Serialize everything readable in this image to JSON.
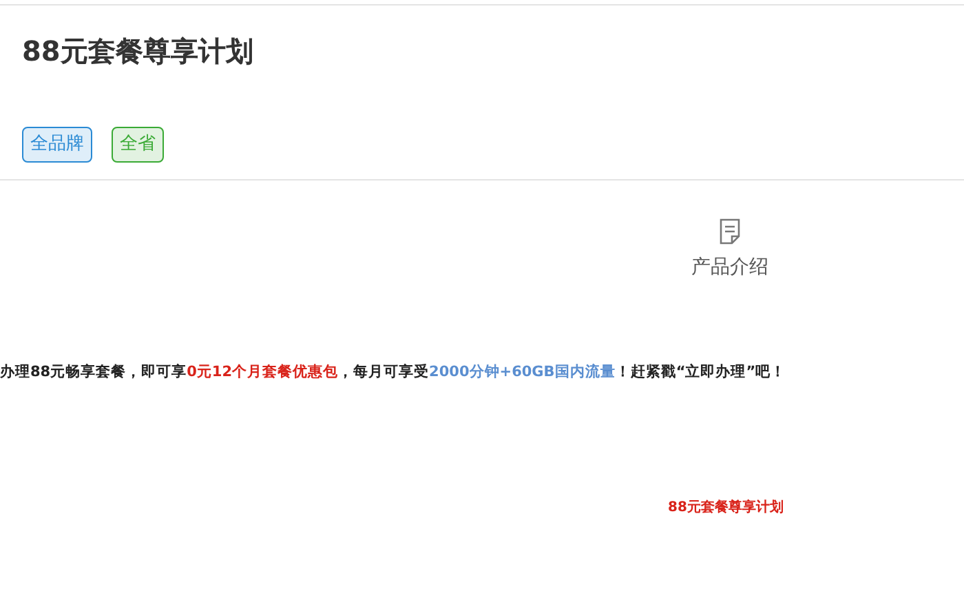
{
  "title": "88元套餐尊享计划",
  "tags": [
    {
      "label": "全品牌",
      "color": "#2a8ad4"
    },
    {
      "label": "全省",
      "color": "#3aaa35"
    }
  ],
  "section": {
    "label": "产品介绍"
  },
  "description": [
    {
      "kind": "plain",
      "text": "办理88元畅享套餐，即可享"
    },
    {
      "kind": "red",
      "text": "0元12个月套餐优惠包"
    },
    {
      "kind": "plain",
      "text": "，每月可享受"
    },
    {
      "kind": "blue",
      "text": "2000分钟+60GB国内流量"
    },
    {
      "kind": "plain",
      "text": "！赶紧戳“立即办理”吧！"
    }
  ],
  "footer_title": "88元套餐尊享计划"
}
